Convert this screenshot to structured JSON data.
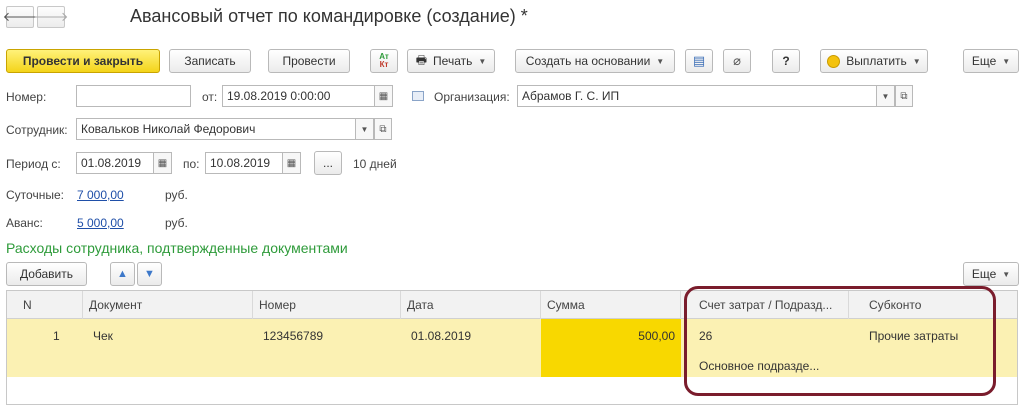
{
  "window": {
    "title": "Авансовый отчет по командировке (создание) *",
    "back_icon": "arrow-left-icon",
    "forward_icon": "arrow-right-icon"
  },
  "toolbar": {
    "post_close": "Провести и закрыть",
    "save": "Записать",
    "post": "Провести",
    "dt_kt_top": "Ат",
    "dt_kt_bottom": "Кт",
    "print": "Печать",
    "create_based": "Создать на основании",
    "help": "?",
    "pay": "Выплатить",
    "more": "Еще"
  },
  "form": {
    "number_label": "Номер:",
    "number_value": "",
    "from_label": "от:",
    "date_value": "19.08.2019  0:00:00",
    "org_label": "Организация:",
    "org_value": "Абрамов Г. С. ИП",
    "employee_label": "Сотрудник:",
    "employee_value": "Ковальков Николай Федорович",
    "period_label": "Период с:",
    "period_from": "01.08.2019",
    "period_to_label": "по:",
    "period_to": "10.08.2019",
    "period_btn": "...",
    "days": "10 дней",
    "daily_label": "Суточные:",
    "daily_value": "7 000,00",
    "daily_unit": "руб.",
    "advance_label": "Аванс:",
    "advance_value": "5 000,00",
    "advance_unit": "руб."
  },
  "section": {
    "title": "Расходы сотрудника, подтвержденные документами",
    "add": "Добавить",
    "more": "Еще"
  },
  "table": {
    "columns": [
      "N",
      "Документ",
      "Номер",
      "Дата",
      "Сумма",
      "Счет затрат / Подразд...",
      "Субконто"
    ],
    "rows": [
      {
        "n": "1",
        "document": "Чек",
        "number": "123456789",
        "date": "01.08.2019",
        "sum": "500,00",
        "account": "26",
        "department": "Основное подразде...",
        "subconto": "Прочие затраты"
      }
    ]
  },
  "colors": {
    "primary_button": "#f4d41a",
    "selected_row": "#fbf1b3",
    "sum_cell": "#f8d800",
    "section_title": "#2e9b3a",
    "highlight_border": "#7a1c2c",
    "link": "#1f4fa8"
  }
}
